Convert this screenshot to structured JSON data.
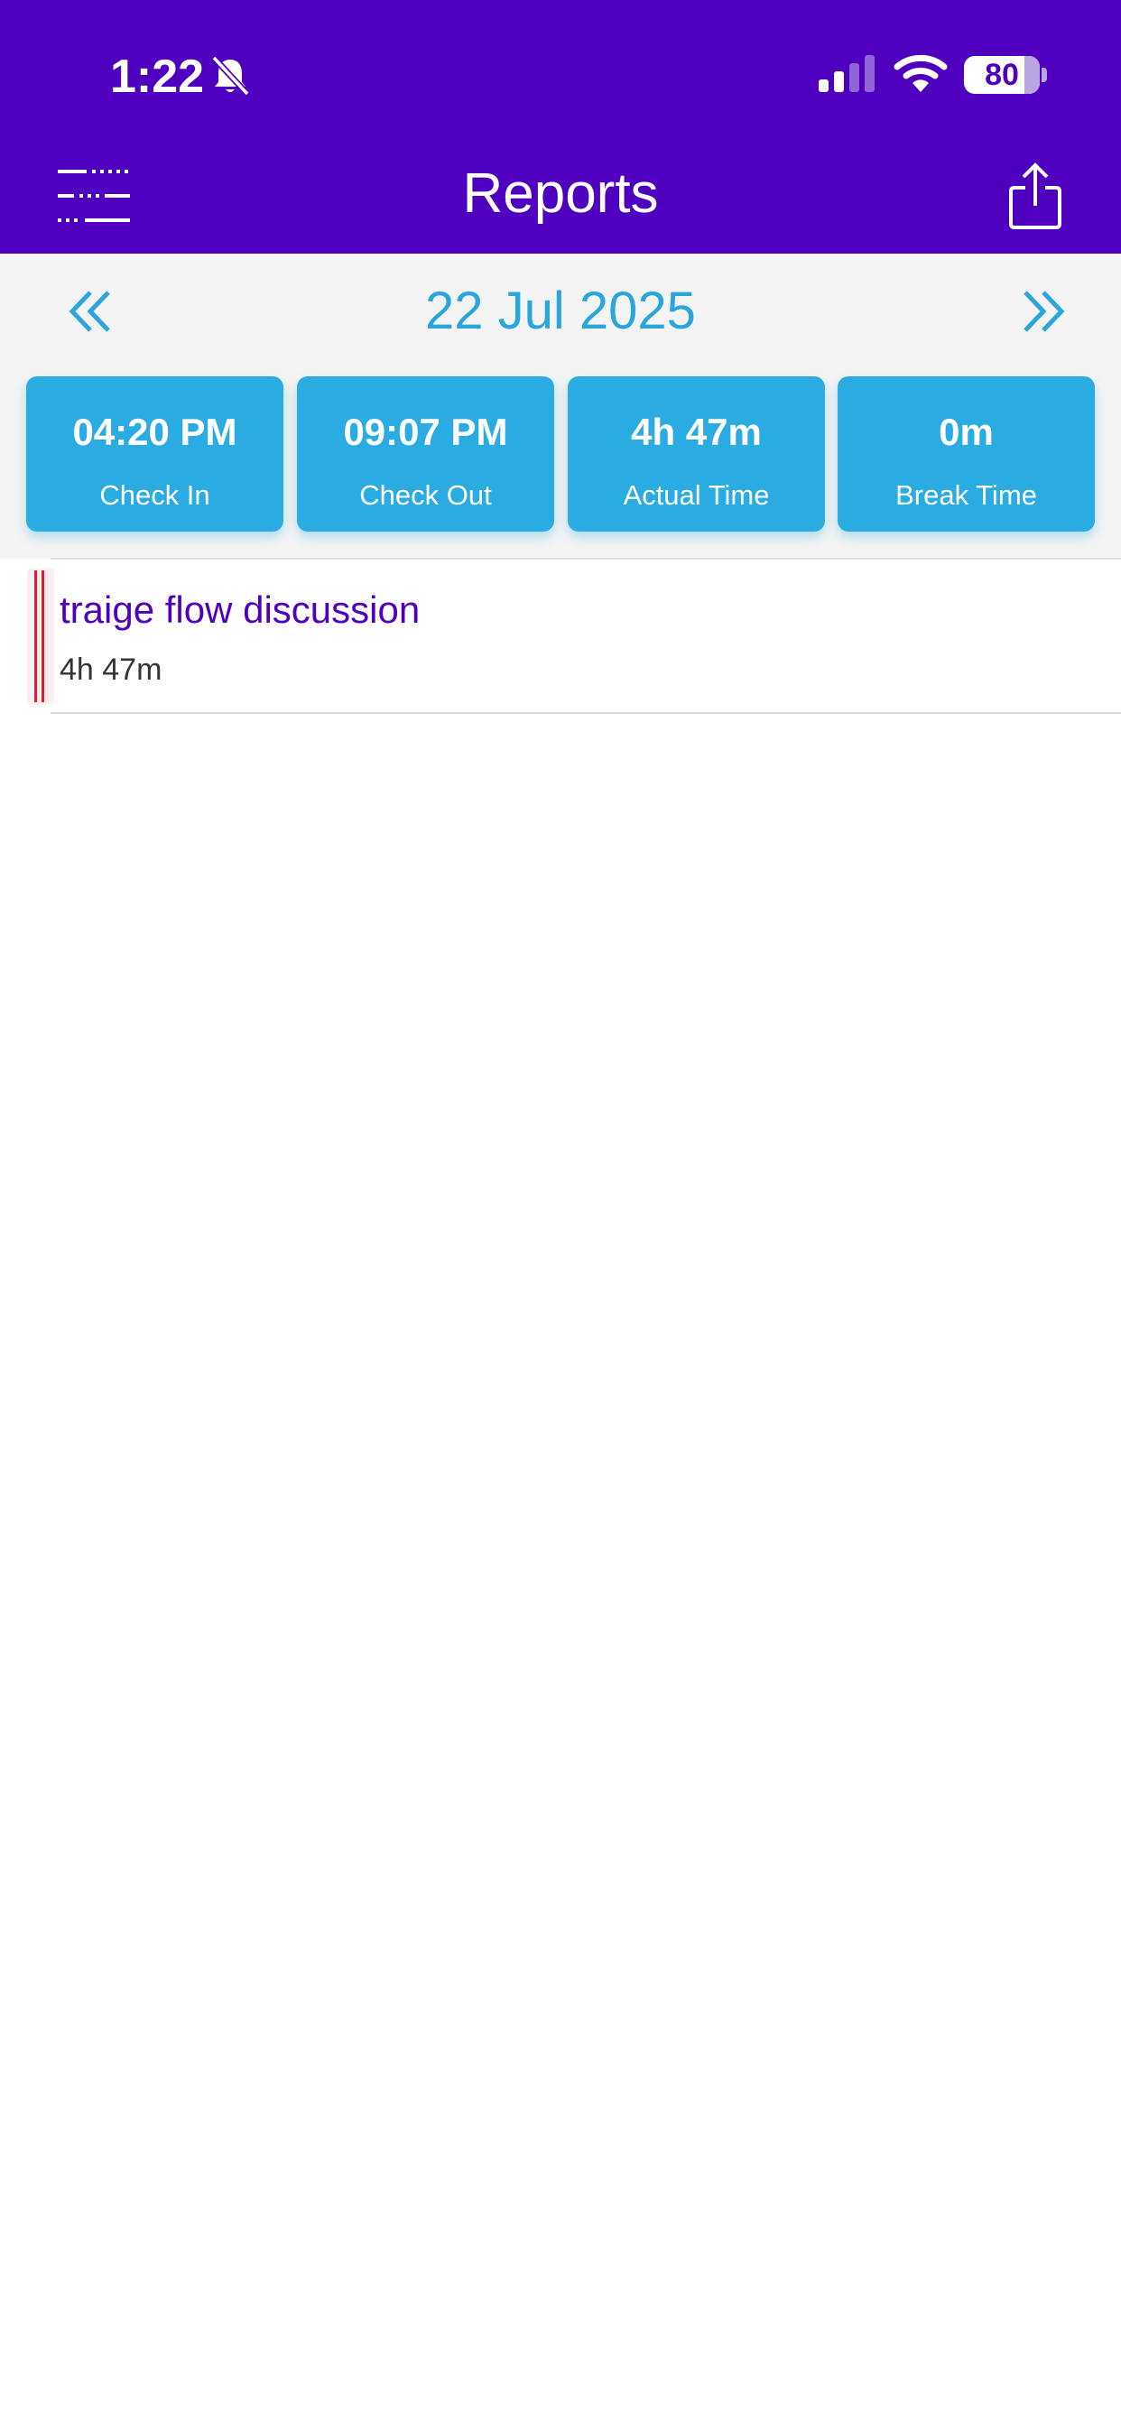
{
  "status_bar": {
    "time": "1:22",
    "battery_level": 80,
    "battery_label": "80"
  },
  "header": {
    "title": "Reports",
    "menu_icon": "menu-icon",
    "share_icon": "share-icon"
  },
  "date_nav": {
    "date": "22 Jul 2025",
    "prev_icon": "chevrons-left-icon",
    "next_icon": "chevrons-right-icon"
  },
  "stats": [
    {
      "value": "04:20 PM",
      "label": "Check In"
    },
    {
      "value": "09:07 PM",
      "label": "Check Out"
    },
    {
      "value": "4h 47m",
      "label": "Actual Time"
    },
    {
      "value": "0m",
      "label": "Break Time"
    }
  ],
  "tasks": [
    {
      "title": "traige flow discussion",
      "duration": "4h 47m"
    }
  ],
  "colors": {
    "header_bg": "#4E00BE",
    "accent": "#2AABE2",
    "marker": "#D8232F"
  }
}
